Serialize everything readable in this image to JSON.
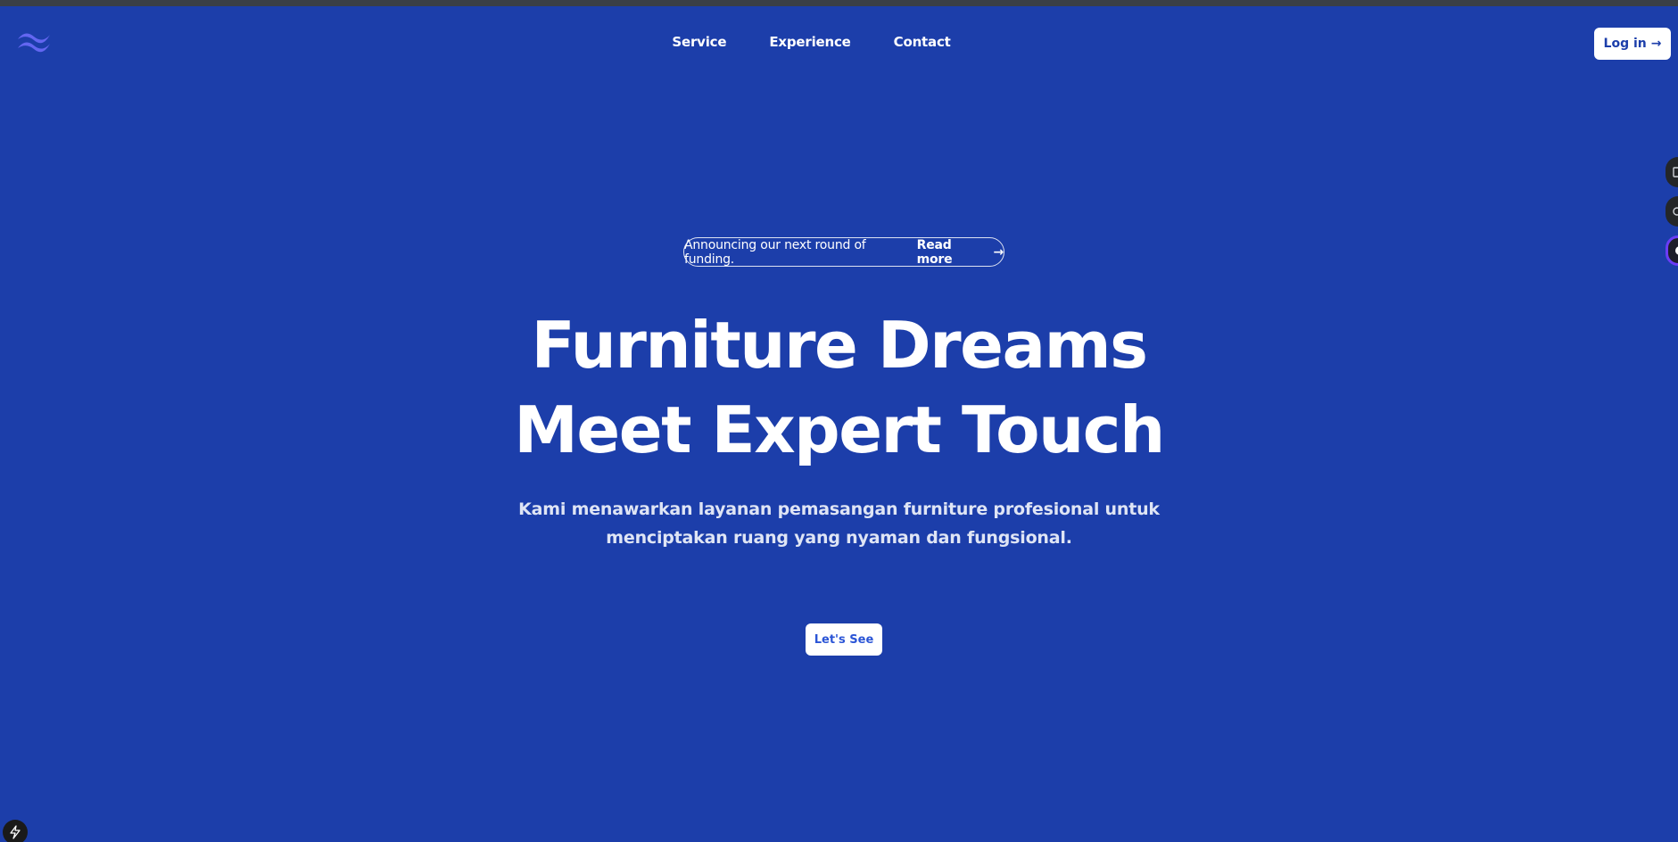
{
  "nav": {
    "logo_icon": "tailwind-wave-icon",
    "links": [
      {
        "label": "Service"
      },
      {
        "label": "Experience"
      },
      {
        "label": "Contact"
      }
    ],
    "login_label": "Log in",
    "login_arrow": "→"
  },
  "hero": {
    "announcement_text": "Announcing our next round of funding.",
    "announcement_link": "Read more",
    "announcement_arrow": "→",
    "title_line1": "Furniture Dreams",
    "title_line2": "Meet Expert Touch",
    "subtitle_line1": "Kami menawarkan layanan pemasangan furniture profesional untuk",
    "subtitle_line2": "menciptakan ruang yang nyaman dan fungsional.",
    "cta_label": "Let's See"
  },
  "colors": {
    "background": "#1c3eaa",
    "accent": "#6366f1",
    "button_bg": "#ffffff",
    "button_text": "#1c3eaa"
  },
  "overlays": {
    "side_widget_1_icon": "ext-icon-1",
    "side_widget_2_icon": "ext-icon-2",
    "side_widget_3_icon": "assistant-icon",
    "corner_badge_icon": "lightning-icon"
  }
}
